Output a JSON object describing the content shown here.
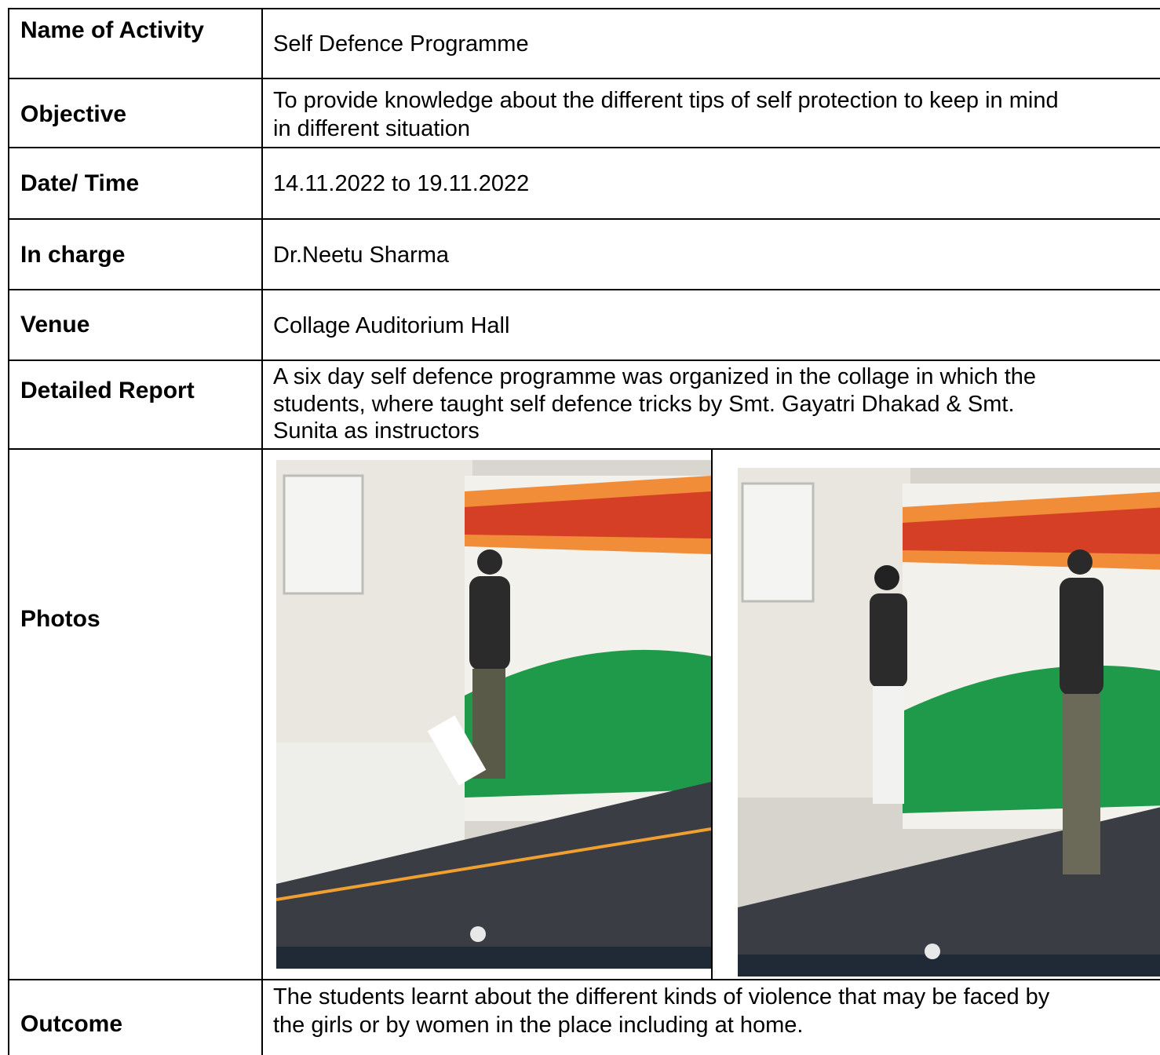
{
  "rows": [
    {
      "label": "Name of Activity",
      "value_lines": [
        "Self Defence Programme"
      ]
    },
    {
      "label": "Objective",
      "value_lines": [
        "To provide knowledge about the different tips of self protection to keep in mind",
        "in different situation"
      ]
    },
    {
      "label": "Date/ Time",
      "value_lines": [
        "14.11.2022 to 19.11.2022"
      ]
    },
    {
      "label": "In charge",
      "value_lines": [
        "Dr.Neetu Sharma"
      ]
    },
    {
      "label": "Venue",
      "value_lines": [
        "Collage Auditorium Hall"
      ]
    },
    {
      "label": "Detailed Report",
      "value_lines": [
        "A six day self defence programme was organized in the collage in which the",
        "students, where taught self defence tricks by Smt. Gayatri Dhakad & Smt.",
        "Sunita as instructors"
      ]
    },
    {
      "label": "Photos",
      "value_lines": []
    },
    {
      "label": "Outcome",
      "value_lines": [
        "The students learnt about the different kinds of violence that may be faced by",
        "the girls or by women in the place including at home."
      ]
    }
  ],
  "photos": [
    {
      "description_icon": "photo-self-defence-demo-1"
    },
    {
      "description_icon": "photo-self-defence-demo-2"
    }
  ],
  "colors": {
    "border": "#000000",
    "banner_green": "#1e9a4a",
    "banner_orange": "#f07a1a",
    "banner_red": "#c81e1e",
    "screen_dark": "#222222"
  }
}
